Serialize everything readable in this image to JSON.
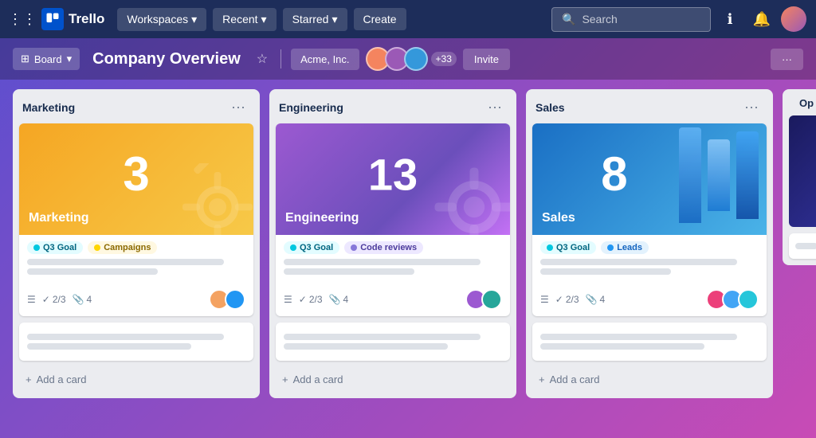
{
  "nav": {
    "logo_text": "Trello",
    "workspaces": "Workspaces",
    "recent": "Recent",
    "starred": "Starred",
    "create": "Create",
    "search_placeholder": "Search"
  },
  "board_header": {
    "view_icon": "⊞",
    "view_label": "Board",
    "title": "Company Overview",
    "workspace_label": "Acme, Inc.",
    "more_members": "+33",
    "invite_label": "Invite",
    "more_label": "···"
  },
  "columns": [
    {
      "id": "marketing",
      "title": "Marketing",
      "cover_number": "3",
      "cover_label": "Marketing",
      "cover_type": "marketing",
      "tags": [
        {
          "label": "Q3 Goal",
          "style": "cyan"
        },
        {
          "label": "Campaigns",
          "style": "yellow"
        }
      ],
      "footer": {
        "checklist": "2/3",
        "attachments": "4"
      },
      "avatars": [
        {
          "color": "#F4A261",
          "initials": ""
        },
        {
          "color": "#2196F3",
          "initials": ""
        }
      ],
      "add_label": "+ Add a card"
    },
    {
      "id": "engineering",
      "title": "Engineering",
      "cover_number": "13",
      "cover_label": "Engineering",
      "cover_type": "engineering",
      "tags": [
        {
          "label": "Q3 Goal",
          "style": "cyan"
        },
        {
          "label": "Code reviews",
          "style": "purple"
        }
      ],
      "footer": {
        "checklist": "2/3",
        "attachments": "4"
      },
      "avatars": [
        {
          "color": "#9C59D1",
          "initials": ""
        },
        {
          "color": "#26A69A",
          "initials": ""
        }
      ],
      "add_label": "+ Add a card"
    },
    {
      "id": "sales",
      "title": "Sales",
      "cover_number": "8",
      "cover_label": "Sales",
      "cover_type": "sales",
      "tags": [
        {
          "label": "Q3 Goal",
          "style": "cyan"
        },
        {
          "label": "Leads",
          "style": "blue"
        }
      ],
      "footer": {
        "checklist": "2/3",
        "attachments": "4"
      },
      "avatars": [
        {
          "color": "#EC407A",
          "initials": ""
        },
        {
          "color": "#42A5F5",
          "initials": ""
        },
        {
          "color": "#26C6DA",
          "initials": ""
        }
      ],
      "add_label": "+ Add a card"
    },
    {
      "id": "operations",
      "title": "Op",
      "cover_type": "partial"
    }
  ]
}
